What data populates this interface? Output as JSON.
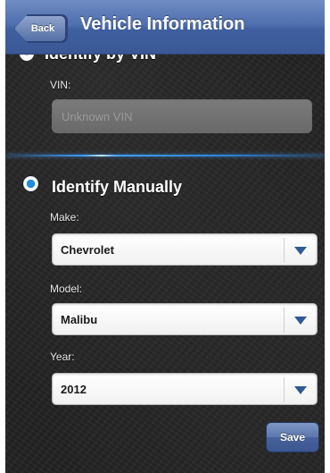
{
  "navbar": {
    "back_label": "Back",
    "title": "Vehicle Information"
  },
  "vin_section": {
    "option_label": "Identify by VIN",
    "selected": false,
    "field_label": "VIN:",
    "placeholder": "Unknown VIN"
  },
  "manual_section": {
    "option_label": "Identify Manually",
    "selected": true,
    "make": {
      "label": "Make:",
      "value": "Chevrolet"
    },
    "model": {
      "label": "Model:",
      "value": "Malibu"
    },
    "year": {
      "label": "Year:",
      "value": "2012"
    }
  },
  "actions": {
    "save_label": "Save"
  },
  "colors": {
    "navbar": "#4f6fae",
    "accent": "#1d8de0",
    "background": "#232323",
    "select_arrow": "#2f5a98"
  },
  "icons": {
    "radio_unselected": "radio-unselected-icon",
    "radio_selected": "radio-selected-icon",
    "dropdown": "chevron-down-icon"
  }
}
